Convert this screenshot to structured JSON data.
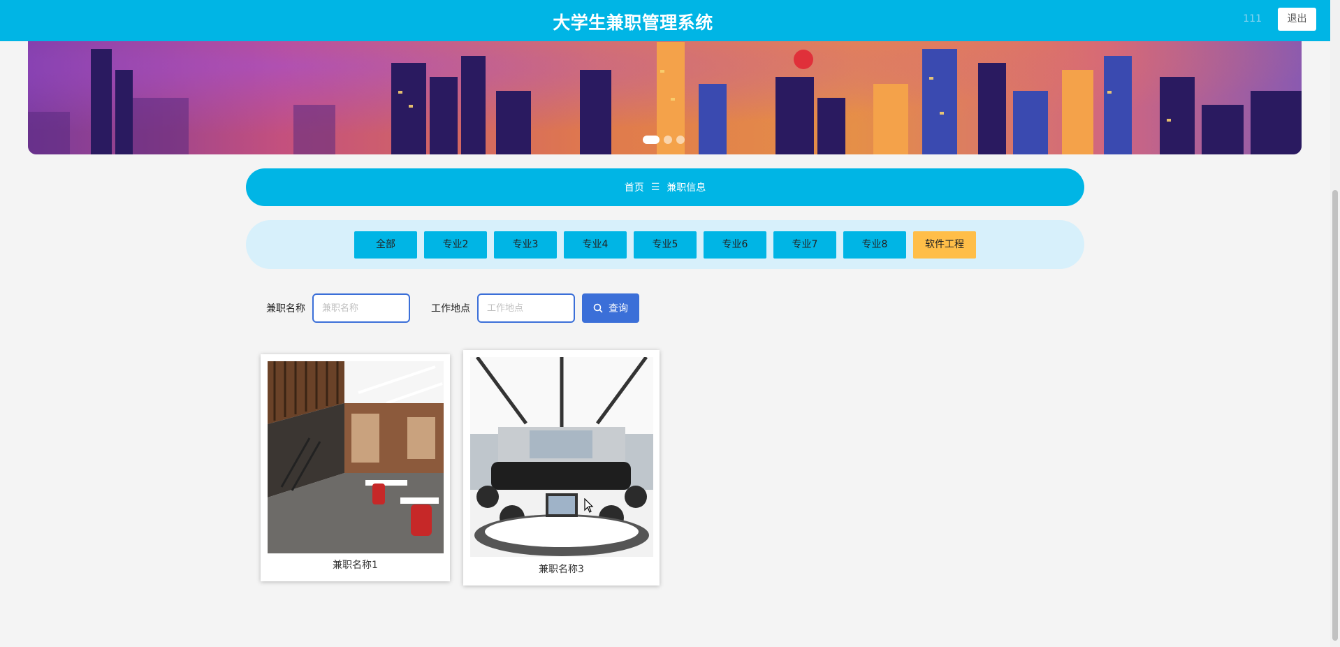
{
  "header": {
    "title": "大学生兼职管理系统",
    "username": "111",
    "logout_label": "退出"
  },
  "carousel": {
    "slides": 3,
    "active_index": 0
  },
  "breadcrumb": {
    "home": "首页",
    "separator": "☰",
    "current": "兼职信息"
  },
  "categories": {
    "items": [
      "全部",
      "专业2",
      "专业3",
      "专业4",
      "专业5",
      "专业6",
      "专业7",
      "专业8",
      "软件工程"
    ],
    "active": "软件工程"
  },
  "search": {
    "name_label": "兼职名称",
    "name_placeholder": "兼职名称",
    "place_label": "工作地点",
    "place_placeholder": "工作地点",
    "button_label": "查询"
  },
  "jobs": [
    {
      "name": "兼职名称1"
    },
    {
      "name": "兼职名称3"
    }
  ],
  "colors": {
    "primary": "#00b5e5",
    "light": "#d7f0fb",
    "accent": "#ffbe48",
    "button": "#3b6fd8",
    "background": "#f4f4f4"
  }
}
